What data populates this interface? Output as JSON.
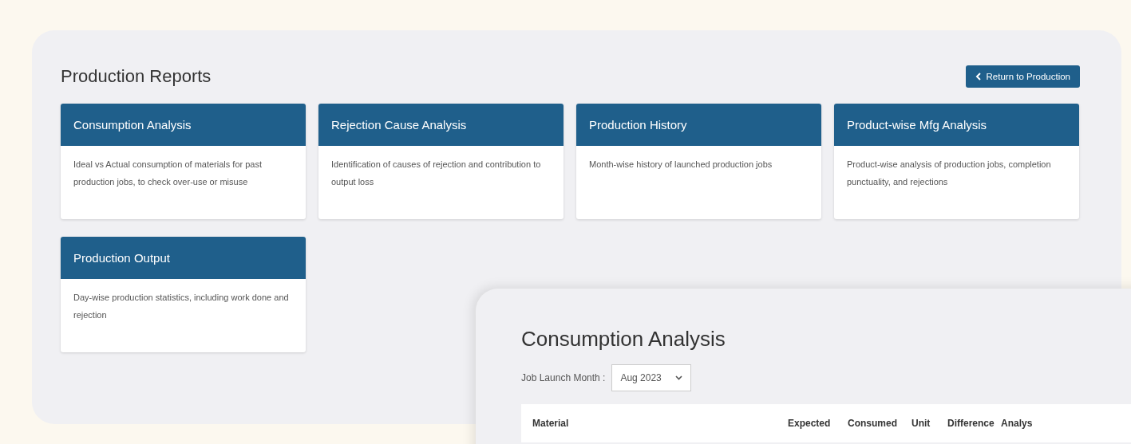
{
  "page": {
    "title": "Production Reports",
    "return_button": {
      "label": "Return to Production"
    }
  },
  "reports": [
    {
      "title": "Consumption Analysis",
      "description": "Ideal vs Actual consumption of materials for past production jobs, to check over-use or misuse"
    },
    {
      "title": "Rejection Cause Analysis",
      "description": "Identification of causes of rejection and contribution to output loss"
    },
    {
      "title": "Production History",
      "description": "Month-wise history of launched production jobs"
    },
    {
      "title": "Product-wise Mfg Analysis",
      "description": "Product-wise analysis of production jobs, completion punctuality, and rejections"
    },
    {
      "title": "Production Output",
      "description": "Day-wise production statistics, including work done and rejection"
    }
  ],
  "detail": {
    "title": "Consumption Analysis",
    "filter_label": "Job Launch Month :",
    "filter_value": "Aug 2023",
    "table": {
      "columns": [
        "Material",
        "Expected",
        "Consumed",
        "Unit",
        "Difference",
        "Analys"
      ]
    }
  }
}
